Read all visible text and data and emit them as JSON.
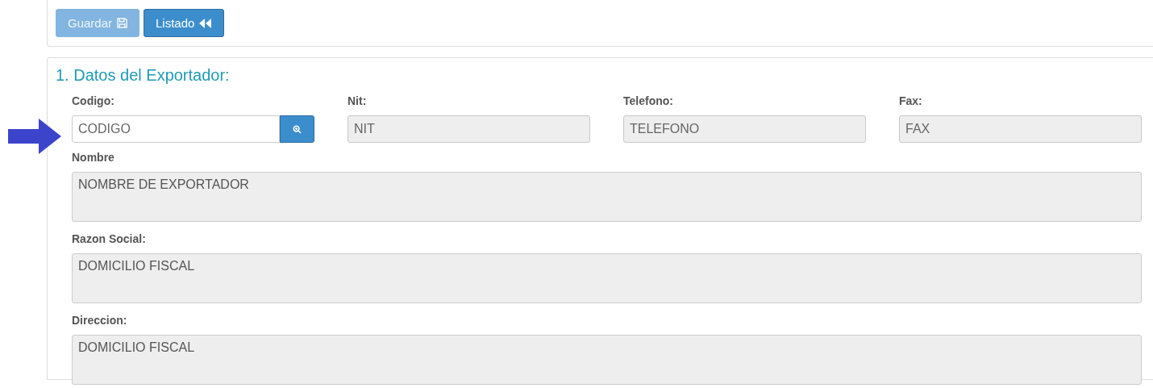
{
  "toolbar": {
    "buttons": [
      {
        "label": "Guardar",
        "kind": "save",
        "disabled": true
      },
      {
        "label": "Listado",
        "kind": "back",
        "disabled": false
      }
    ]
  },
  "section": {
    "title": "1. Datos del Exportador:",
    "fields": [
      {
        "label": "Codigo:",
        "placeholder": "CODIGO",
        "kind": "search",
        "disabled": false
      },
      {
        "label": "Nit:",
        "placeholder": "NIT",
        "kind": "text",
        "disabled": true
      },
      {
        "label": "Telefono:",
        "placeholder": "TELEFONO",
        "kind": "text",
        "disabled": true
      },
      {
        "label": "Fax:",
        "placeholder": "FAX",
        "kind": "text",
        "disabled": true
      }
    ],
    "areas": [
      {
        "label": "Nombre",
        "placeholder": "NOMBRE DE EXPORTADOR",
        "disabled": true
      },
      {
        "label": "Razon Social:",
        "placeholder": "DOMICILIO FISCAL",
        "disabled": true
      },
      {
        "label": "Direccion:",
        "placeholder": "DOMICILIO FISCAL",
        "disabled": true
      }
    ]
  }
}
